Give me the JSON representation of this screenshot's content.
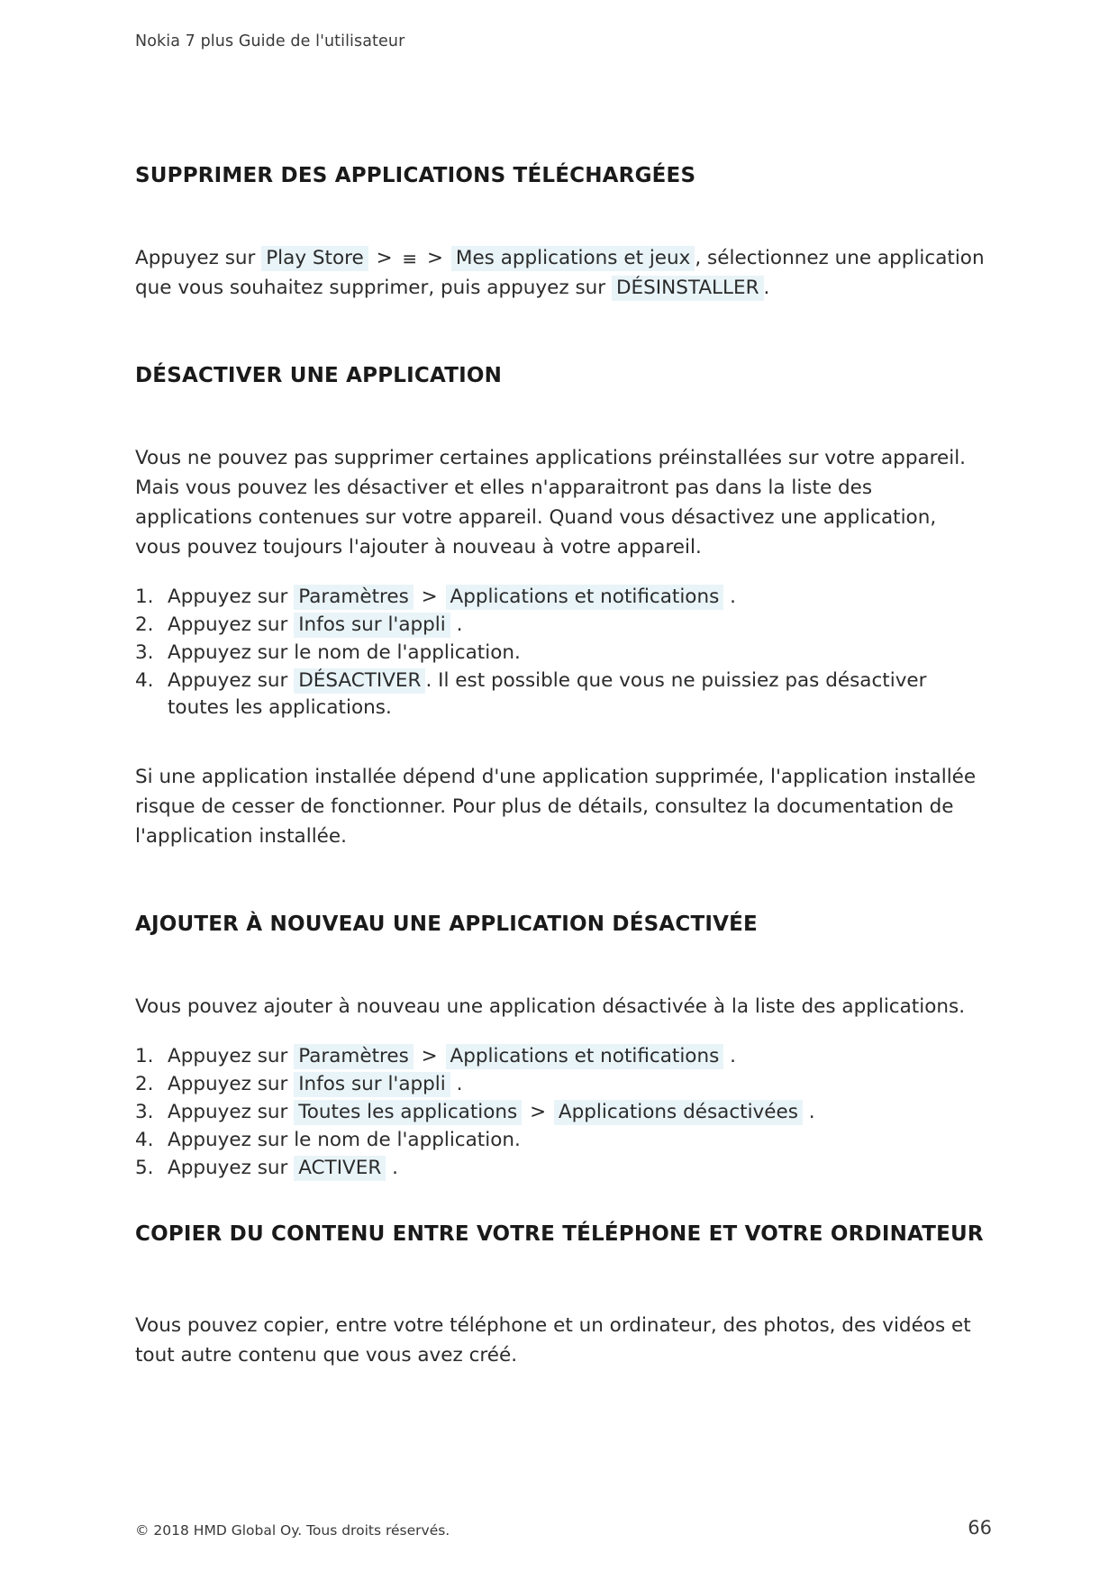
{
  "header": {
    "running_title": "Nokia 7 plus Guide de l'utilisateur"
  },
  "theme": {
    "chip_background": "#e9f4f8",
    "text_color": "#2b2b2b",
    "heading_color": "#1a1a1a",
    "page_background": "#ffffff"
  },
  "sections": {
    "remove_downloaded": {
      "title": "SUPPRIMER DES APPLICATIONS TÉLÉCHARGÉES",
      "paragraph": {
        "t1": "Appuyez sur",
        "chip1": "Play Store",
        "sep1": ">",
        "menu_icon": "≡",
        "sep2": ">",
        "chip2": "Mes applications et jeux",
        "t2": ", sélectionnez une application que vous souhaitez supprimer, puis appuyez sur",
        "chip3": "DÉSINSTALLER",
        "t3": "."
      }
    },
    "disable_app": {
      "title": "DÉSACTIVER UNE APPLICATION",
      "intro": "Vous ne pouvez pas supprimer certaines applications préinstallées sur votre appareil. Mais vous pouvez les désactiver et elles n'apparaitront pas dans la liste des applications contenues sur votre appareil. Quand vous désactivez une application, vous pouvez toujours l'ajouter à nouveau à votre appareil.",
      "steps": [
        {
          "num": "1.",
          "t1": "Appuyez sur",
          "chip1": "Paramètres",
          "sep1": ">",
          "chip2": "Applications et notifications",
          "t2": "."
        },
        {
          "num": "2.",
          "t1": "Appuyez sur",
          "chip1": "Infos sur l'appli",
          "t2": "."
        },
        {
          "num": "3.",
          "t1": "Appuyez sur le nom de l'application."
        },
        {
          "num": "4.",
          "t1": "Appuyez sur",
          "chip1": "DÉSACTIVER",
          "t2": ". Il est possible que vous ne puissiez pas désactiver toutes les applications."
        }
      ],
      "outro": "Si une application installée dépend d'une application supprimée, l'application installée risque de cesser de fonctionner. Pour plus de détails, consultez la documentation de l'application installée."
    },
    "readd_app": {
      "title": "AJOUTER À NOUVEAU UNE APPLICATION DÉSACTIVÉE",
      "intro": "Vous pouvez ajouter à nouveau une application désactivée à la liste des applications.",
      "steps": [
        {
          "num": "1.",
          "t1": "Appuyez sur",
          "chip1": "Paramètres",
          "sep1": ">",
          "chip2": "Applications et notifications",
          "t2": "."
        },
        {
          "num": "2.",
          "t1": "Appuyez sur",
          "chip1": "Infos sur l'appli",
          "t2": "."
        },
        {
          "num": "3.",
          "t1": "Appuyez sur",
          "chip1": "Toutes les applications",
          "sep1": ">",
          "chip2": "Applications désactivées",
          "t2": "."
        },
        {
          "num": "4.",
          "t1": "Appuyez sur le nom de l'application."
        },
        {
          "num": "5.",
          "t1": "Appuyez sur",
          "chip1": "ACTIVER",
          "t2": "."
        }
      ]
    },
    "copy_content": {
      "title": "COPIER DU CONTENU ENTRE VOTRE TÉLÉPHONE ET VOTRE ORDINATEUR",
      "paragraph": "Vous pouvez copier, entre votre téléphone et un ordinateur, des photos, des vidéos et tout autre contenu que vous avez créé."
    }
  },
  "footer": {
    "copyright": "© 2018 HMD Global Oy. Tous droits réservés.",
    "page_number": "66"
  }
}
